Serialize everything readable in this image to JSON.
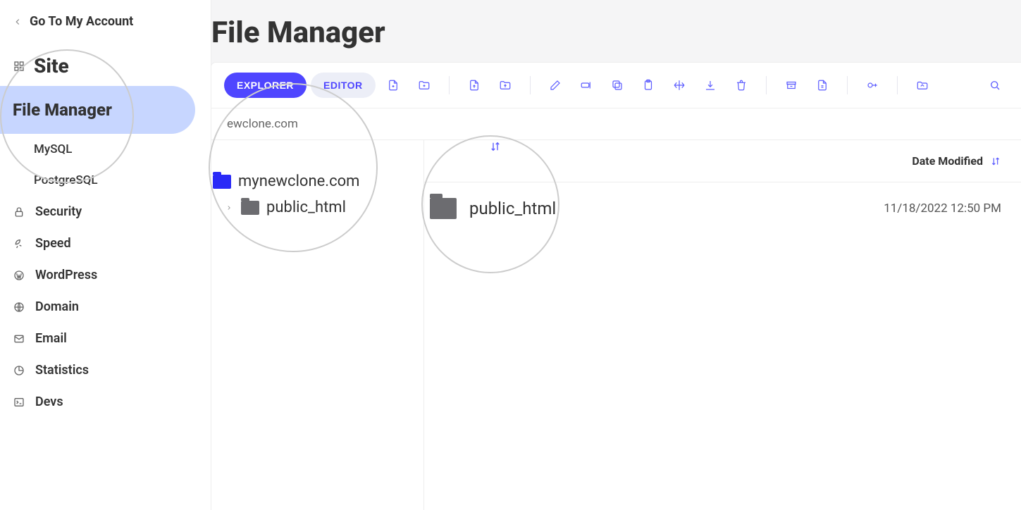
{
  "back_label": "Go To My Account",
  "site_group_label": "Site",
  "nav": {
    "file_manager": "File Manager",
    "mysql": "MySQL",
    "postgresql": "PostgreSQL",
    "security": "Security",
    "speed": "Speed",
    "wordpress": "WordPress",
    "domain": "Domain",
    "email": "Email",
    "statistics": "Statistics",
    "devs": "Devs"
  },
  "page_title": "File Manager",
  "tabs": {
    "explorer": "EXPLORER",
    "editor": "EDITOR"
  },
  "breadcrumb": "ewclone.com",
  "tree": {
    "root": "mynewclone.com",
    "child": "public_html"
  },
  "columns": {
    "date_modified": "Date Modified"
  },
  "listing": {
    "name": "public_html",
    "date": "11/18/2022 12:50 PM"
  },
  "colors": {
    "accent": "#4f46ff",
    "folder_active": "#2a2af7",
    "folder_grey": "#6c6c70",
    "nav_active_bg": "#c7d6ff"
  }
}
